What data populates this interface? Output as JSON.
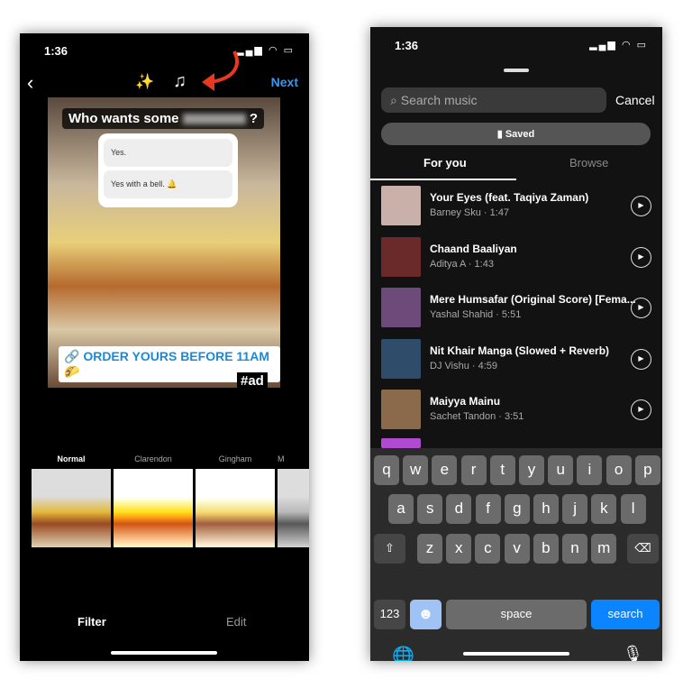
{
  "left": {
    "time": "1:36",
    "next": "Next",
    "story": {
      "question": "Who wants some",
      "question_end": "?",
      "options": [
        "Yes.",
        "Yes with a bell. 🔔"
      ],
      "cta": "🔗 ORDER YOURS BEFORE 11AM 🌮",
      "tag": "#ad"
    },
    "filters": [
      "Normal",
      "Clarendon",
      "Gingham",
      "M"
    ],
    "tabs": [
      "Filter",
      "Edit"
    ],
    "accent": "#3897f0",
    "arrow_color": "#e8381f"
  },
  "right": {
    "time": "1:36",
    "search_placeholder": "Search music",
    "cancel": "Cancel",
    "saved": "Saved",
    "tabs": [
      "For you",
      "Browse"
    ],
    "songs": [
      {
        "title": "Your Eyes (feat. Taqiya Zaman)",
        "meta": "Barney Sku · 1:47",
        "color": "#c9b1a9"
      },
      {
        "title": "Chaand Baaliyan",
        "meta": "Aditya A · 1:43",
        "color": "#6b2a2a"
      },
      {
        "title": "Mere Humsafar (Original Score) [Fema...",
        "meta": "Yashal Shahid · 5:51",
        "color": "#6c4b7a"
      },
      {
        "title": "Nit Khair Manga (Slowed + Reverb)",
        "meta": "DJ Vishu · 4:59",
        "color": "#2f4d6a"
      },
      {
        "title": "Maiyya Mainu",
        "meta": "Sachet Tandon · 3:51",
        "color": "#8a6a4a"
      }
    ],
    "keyboard": {
      "row1": [
        "q",
        "w",
        "e",
        "r",
        "t",
        "y",
        "u",
        "i",
        "o",
        "p"
      ],
      "row2": [
        "a",
        "s",
        "d",
        "f",
        "g",
        "h",
        "j",
        "k",
        "l"
      ],
      "row3": [
        "z",
        "x",
        "c",
        "v",
        "b",
        "n",
        "m"
      ],
      "num": "123",
      "space": "space",
      "search": "search"
    },
    "search_key_color": "#0a84ff"
  }
}
